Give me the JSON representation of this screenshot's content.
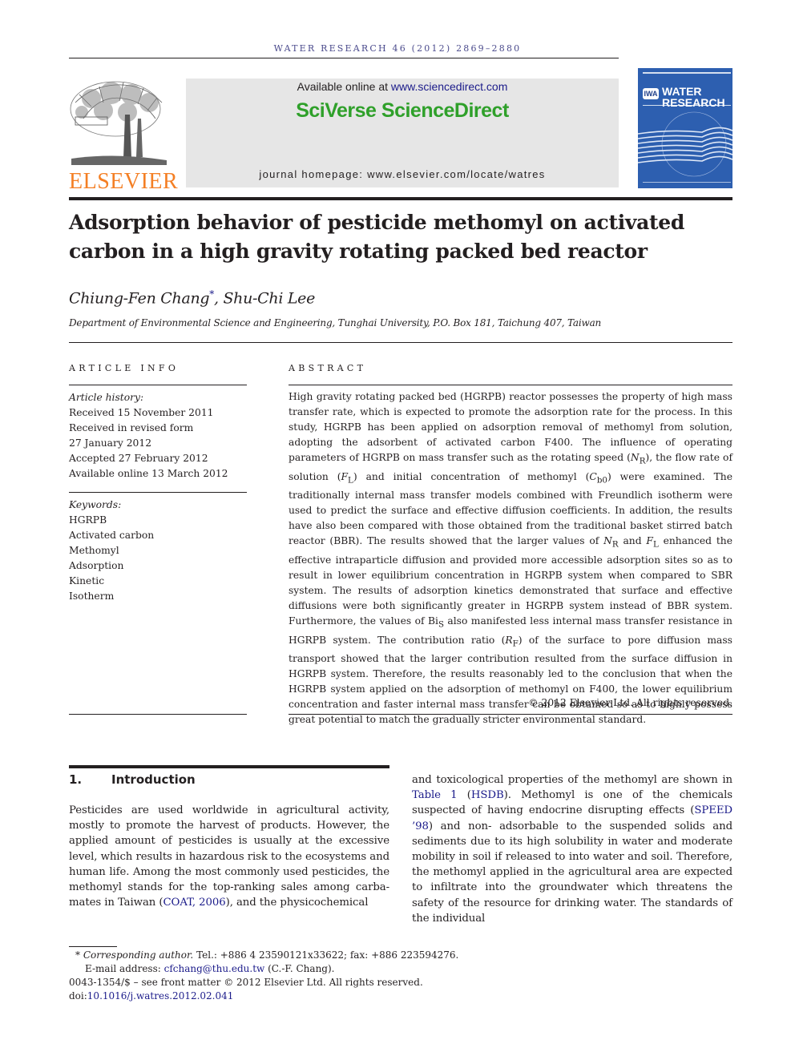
{
  "header": {
    "running_head": "WATER RESEARCH 46 (2012) 2869–2880",
    "publisher_name": "ELSEVIER",
    "available_prefix": "Available online at ",
    "available_link": "www.sciencedirect.com",
    "brand": "SciVerse ScienceDirect",
    "homepage": "journal homepage: www.elsevier.com/locate/watres",
    "cover": {
      "badge": "IWA",
      "title_line1": "WATER",
      "title_line2": "RESEARCH"
    },
    "colors": {
      "elsevier_orange": "#f47f24",
      "sciencedirect_green": "#2fa02a",
      "link_blue": "#1b1b8a",
      "cover_blue": "#2d5fb0"
    }
  },
  "article": {
    "title": "Adsorption behavior of pesticide methomyl on activated carbon in a high gravity rotating packed bed reactor",
    "authors": [
      {
        "name": "Chiung-Fen Chang",
        "mark": "*"
      },
      {
        "name": "Shu-Chi Lee",
        "mark": ""
      }
    ],
    "author_separator": ", ",
    "affiliation": "Department of Environmental Science and Engineering, Tunghai University, P.O. Box 181, Taichung 407, Taiwan"
  },
  "article_info": {
    "label": "ARTICLE INFO",
    "history_label": "Article history:",
    "history": [
      "Received 15 November 2011",
      "Received in revised form",
      "27 January 2012",
      "Accepted 27 February 2012",
      "Available online 13 March 2012"
    ],
    "keywords_label": "Keywords:",
    "keywords": [
      "HGRPB",
      "Activated carbon",
      "Methomyl",
      "Adsorption",
      "Kinetic",
      "Isotherm"
    ]
  },
  "abstract": {
    "label": "ABSTRACT",
    "p1": "High gravity rotating packed bed (HGRPB) reactor possesses the property of high mass transfer rate, which is expected to promote the adsorption rate for the process. In this study, HGRPB has been applied on adsorption removal of methomyl from solution, adopting the adsorbent of activated carbon F400. The influence of operating parameters of HGRPB on mass transfer such as the rotating speed (",
    "nr": "N",
    "nr_sub": "R",
    "p2": "), the flow rate of solution (",
    "fl": "F",
    "fl_sub": "L",
    "p3": ") and initial concentration of methomyl (",
    "cb": "C",
    "cb_sub": "b0",
    "p4": ") were examined. The traditionally internal mass transfer models combined with Freundlich isotherm were used to predict the surface and effective diffusion coefficients. In addition, the results have also been compared with those obtained from the traditional basket stirred batch reactor (BBR). The results showed that the larger values of ",
    "p5": " and ",
    "p6": " enhanced the effective intraparticle diffusion and provided more accessible adsorption sites so as to result in lower equilibrium concentration in HGRPB system when compared to SBR system. The results of adsorption kinetics demonstrated that surface and effective diffusions were both significantly greater in HGRPB system instead of BBR system. Furthermore, the values of ",
    "bi": "Bi",
    "bi_sub": "S",
    "p7": " also manifested less internal mass transfer resistance in HGRPB system. The contribution ratio (",
    "rf": "R",
    "rf_sub": "F",
    "p8": ") of the surface to pore diffusion mass transport showed that the larger contribution resulted from the surface diffusion in HGRPB system. Therefore, the results reasonably led to the conclusion that when the HGRPB system applied on the adsorption of methomyl on F400, the lower equilibrium concentration and faster internal mass transfer can be obtained so as to highly possess great potential to match the gradually stricter environmental standard.",
    "copyright": "© 2012 Elsevier Ltd. All rights reserved."
  },
  "introduction": {
    "number": "1.",
    "heading": "Introduction",
    "left_a": "Pesticides are used worldwide in agricultural activity, mostly to promote the harvest of products. However, the applied amount of pesticides is usually at the excessive level, which results in hazardous risk to the ecosystems and human life. Among the most commonly used pesticides, the methomyl stands for the top-ranking sales among carba- mates in Taiwan (",
    "ref_coat": "COAT, 2006",
    "left_b": "), and the physicochemical",
    "right_a": "and toxicological properties of the methomyl are shown in ",
    "ref_table": "Table 1",
    "right_b": " (",
    "ref_hsdb": "HSDB",
    "right_c": "). Methomyl is one of the chemicals suspected of having endocrine disrupting effects (",
    "ref_speed": "SPEED ’98",
    "right_d": ") and non- adsorbable to the suspended solids and sediments due to its high solubility in water and moderate mobility in soil if released to into water and soil. Therefore, the methomyl applied in the agricultural area are expected to infiltrate into the groundwater which threatens the safety of the resource for drinking water. The standards of the individual"
  },
  "footnotes": {
    "star": "*",
    "corresponding_label": "Corresponding author.",
    "contact": " Tel.: +886 4 23590121x33622; fax: +886 223594276.",
    "email_label": "E-mail address: ",
    "email": "cfchang@thu.edu.tw",
    "email_suffix": " (C.-F. Chang).",
    "issn": "0043-1354/$ – see front matter © 2012 Elsevier Ltd. All rights reserved.",
    "doi_prefix": "doi:",
    "doi": "10.1016/j.watres.2012.02.041"
  }
}
